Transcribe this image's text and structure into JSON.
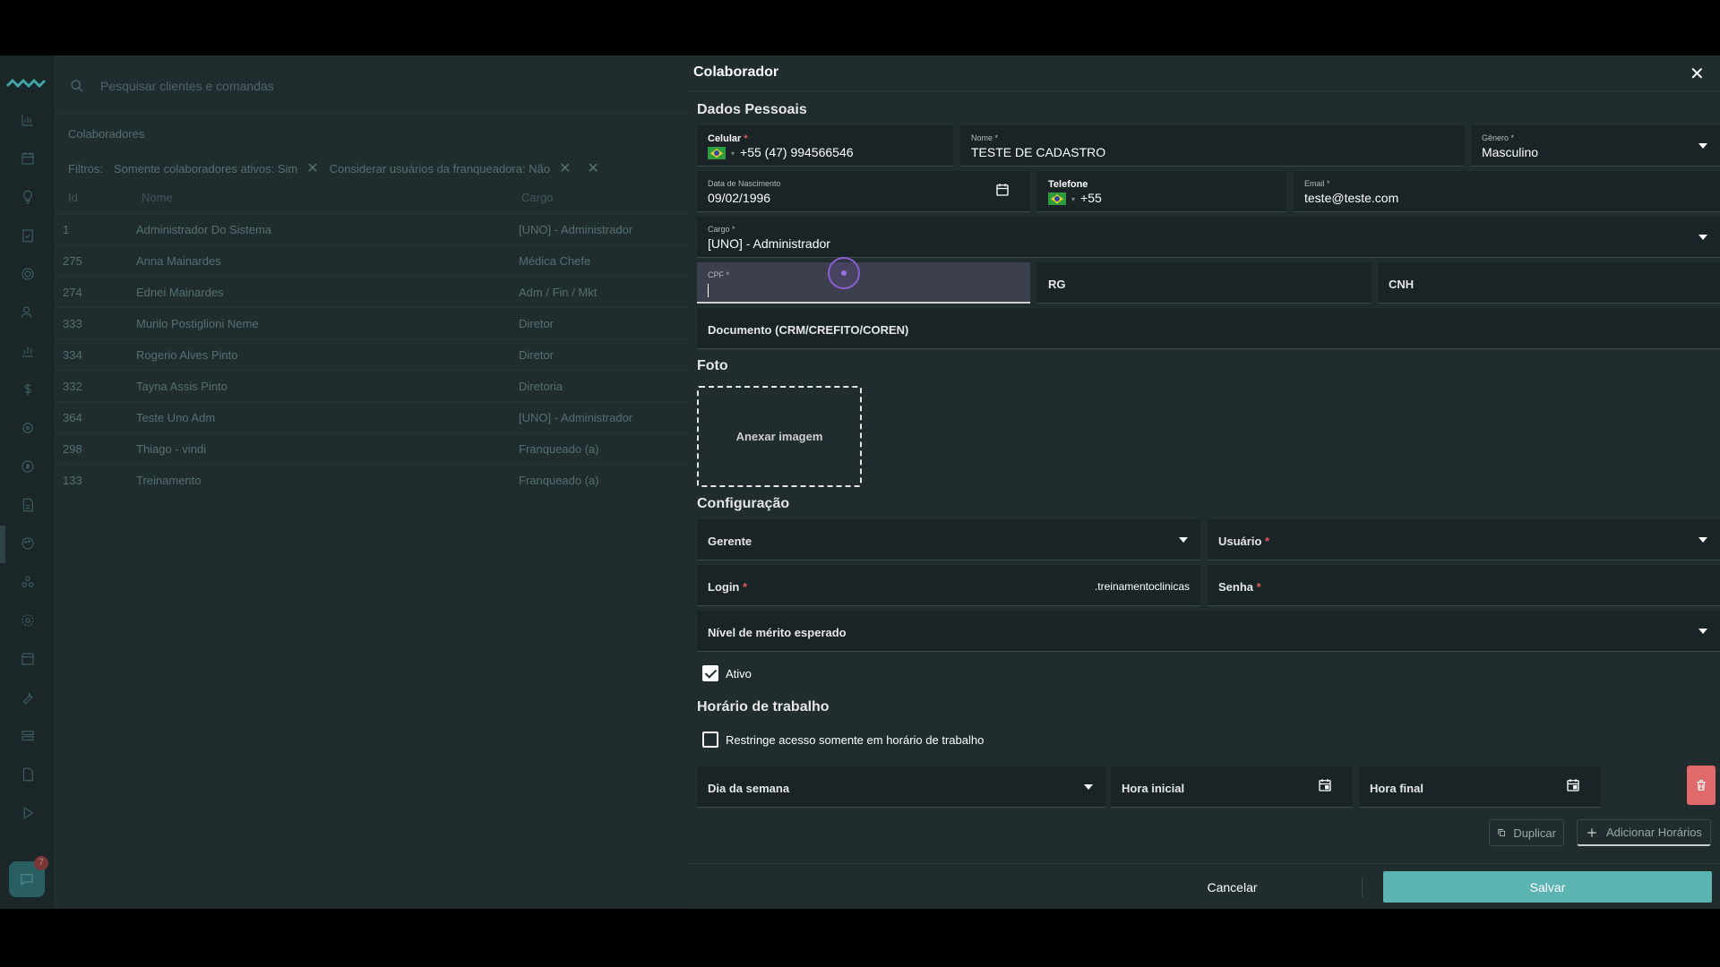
{
  "search": {
    "placeholder": "Pesquisar clientes e comandas"
  },
  "list": {
    "title": "Colaboradores",
    "filters_label": "Filtros:",
    "filters": [
      "Somente colaboradores ativos: Sim",
      "Considerar usuários da franqueadora: Não"
    ],
    "columns": {
      "id": "Id",
      "name": "Nome",
      "role": "Cargo"
    },
    "rows": [
      {
        "id": "1",
        "name": "Administrador Do Sistema",
        "role": "[UNO] - Administrador"
      },
      {
        "id": "275",
        "name": "Anna Mainardes",
        "role": "Médica Chefe"
      },
      {
        "id": "274",
        "name": "Ednei Mainardes",
        "role": "Adm / Fin / Mkt"
      },
      {
        "id": "333",
        "name": "Murilo Postiglioni Neme",
        "role": "Diretor"
      },
      {
        "id": "334",
        "name": "Rogerio Alves Pinto",
        "role": "Diretor"
      },
      {
        "id": "332",
        "name": "Tayna Assis Pinto",
        "role": "Diretoria"
      },
      {
        "id": "364",
        "name": "Teste Uno Adm",
        "role": "[UNO] - Administrador"
      },
      {
        "id": "298",
        "name": "Thiago - vindi",
        "role": "Franqueado (a)"
      },
      {
        "id": "133",
        "name": "Treinamento",
        "role": "Franqueado (a)"
      }
    ]
  },
  "chat_badge": "7",
  "panel": {
    "title": "Colaborador",
    "close": "✕",
    "sections": {
      "personal": "Dados Pessoais",
      "photo": "Foto",
      "config": "Configuração",
      "schedule": "Horário de trabalho"
    },
    "fields": {
      "celular": {
        "label": "Celular",
        "value": "+55 (47) 994566546"
      },
      "nome": {
        "label": "Nome",
        "value": "TESTE DE CADASTRO"
      },
      "genero": {
        "label": "Gênero",
        "value": "Masculino"
      },
      "nascimento": {
        "label": "Data de Nascimento",
        "value": "09/02/1996"
      },
      "telefone": {
        "label": "Telefone",
        "value": "+55"
      },
      "email": {
        "label": "Email",
        "value": "teste@teste.com"
      },
      "cargo": {
        "label": "Cargo",
        "value": "[UNO] - Administrador"
      },
      "cpf": {
        "label": "CPF",
        "value": ""
      },
      "rg": {
        "label": "RG"
      },
      "cnh": {
        "label": "CNH"
      },
      "documento": {
        "label": "Documento (CRM/CREFITO/COREN)"
      },
      "gerente": {
        "label": "Gerente"
      },
      "usuario": {
        "label": "Usuário"
      },
      "login": {
        "label": "Login",
        "suffix": ".treinamentoclinicas"
      },
      "senha": {
        "label": "Senha"
      },
      "merito": {
        "label": "Nível de mérito esperado"
      },
      "dia": {
        "label": "Dia da semana"
      },
      "hora_inicial": {
        "label": "Hora inicial"
      },
      "hora_final": {
        "label": "Hora final"
      }
    },
    "required_mark": "*",
    "photo_attach": "Anexar imagem",
    "ativo": {
      "label": "Ativo",
      "checked": true
    },
    "restringe": {
      "label": "Restringe acesso somente em horário de trabalho",
      "checked": false
    },
    "buttons": {
      "duplicar": "Duplicar",
      "adicionar": "Adicionar Horários",
      "cancelar": "Cancelar",
      "salvar": "Salvar"
    }
  },
  "colors": {
    "accent": "#5bb3b2",
    "danger": "#e06a6a",
    "panel_bg": "#202c2e"
  }
}
